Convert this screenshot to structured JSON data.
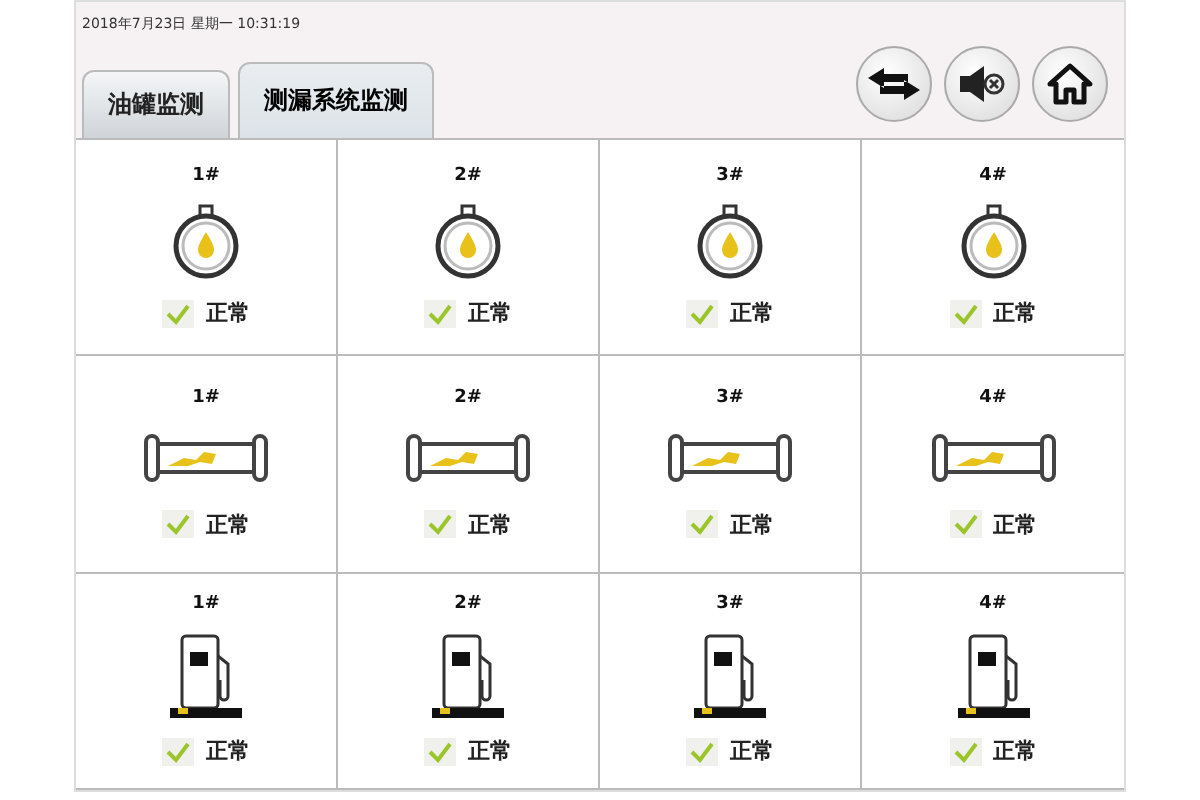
{
  "header": {
    "datetime": "2018年7月23日 星期一 10:31:19"
  },
  "tabs": [
    {
      "label": "油罐监测",
      "selected": false
    },
    {
      "label": "测漏系统监测",
      "selected": true
    }
  ],
  "grid_rows": [
    {
      "kind": "tank",
      "cells": [
        {
          "label": "1#",
          "status": "正常",
          "ok": true
        },
        {
          "label": "2#",
          "status": "正常",
          "ok": true
        },
        {
          "label": "3#",
          "status": "正常",
          "ok": true
        },
        {
          "label": "4#",
          "status": "正常",
          "ok": true
        }
      ]
    },
    {
      "kind": "pipe",
      "cells": [
        {
          "label": "1#",
          "status": "正常",
          "ok": true
        },
        {
          "label": "2#",
          "status": "正常",
          "ok": true
        },
        {
          "label": "3#",
          "status": "正常",
          "ok": true
        },
        {
          "label": "4#",
          "status": "正常",
          "ok": true
        }
      ]
    },
    {
      "kind": "dispenser",
      "cells": [
        {
          "label": "1#",
          "status": "正常",
          "ok": true
        },
        {
          "label": "2#",
          "status": "正常",
          "ok": true
        },
        {
          "label": "3#",
          "status": "正常",
          "ok": true
        },
        {
          "label": "4#",
          "status": "正常",
          "ok": true
        }
      ]
    }
  ]
}
